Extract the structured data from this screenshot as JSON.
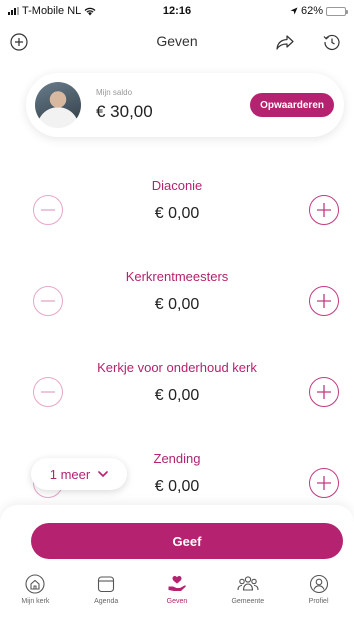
{
  "status_bar": {
    "carrier": "T-Mobile NL",
    "time": "12:16",
    "battery": "62%",
    "battery_level": 0.62
  },
  "header": {
    "title": "Geven",
    "icons": [
      "add-circle-icon",
      "share-icon",
      "history-icon"
    ]
  },
  "saldo": {
    "label": "Mijn saldo",
    "amount": "€ 30,00",
    "topup_label": "Opwaarderen"
  },
  "funds": [
    {
      "name": "Diaconie",
      "amount": "€ 0,00"
    },
    {
      "name": "Kerkrentmeesters",
      "amount": "€ 0,00"
    },
    {
      "name": "Kerkje voor onderhoud kerk",
      "amount": "€ 0,00"
    },
    {
      "name": "Zending",
      "amount": "€ 0,00"
    }
  ],
  "more": {
    "label": "1 meer"
  },
  "give_button": {
    "label": "Geef"
  },
  "tabs": [
    {
      "label": "Mijn kerk",
      "icon": "church-icon"
    },
    {
      "label": "Agenda",
      "icon": "calendar-icon"
    },
    {
      "label": "Geven",
      "icon": "give-hand-icon",
      "active": true
    },
    {
      "label": "Gemeente",
      "icon": "people-icon"
    },
    {
      "label": "Profiel",
      "icon": "profile-icon"
    }
  ],
  "colors": {
    "accent": "#b5226f",
    "minus_border": "#e6a6c8"
  }
}
